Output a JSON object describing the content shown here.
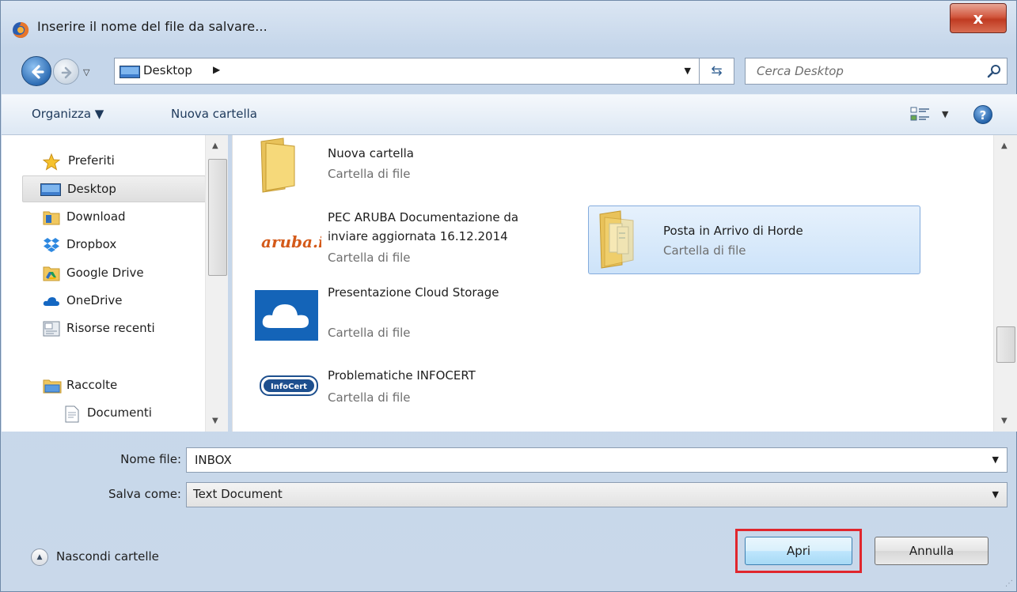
{
  "window": {
    "title": "Inserire il nome del file da salvare...",
    "close_glyph": "x"
  },
  "address": {
    "location": "Desktop",
    "separator_glyph": "▶",
    "search_placeholder": "Cerca Desktop"
  },
  "toolbar": {
    "organize_label": "Organizza ▼",
    "new_folder_label": "Nuova cartella",
    "help_glyph": "?"
  },
  "navigation": {
    "items": [
      {
        "label": "Preferiti",
        "icon": "star-icon"
      },
      {
        "label": "Desktop",
        "icon": "desktop-icon",
        "selected": true
      },
      {
        "label": "Download",
        "icon": "download-folder-icon"
      },
      {
        "label": "Dropbox",
        "icon": "dropbox-icon"
      },
      {
        "label": "Google Drive",
        "icon": "google-drive-icon"
      },
      {
        "label": "OneDrive",
        "icon": "onedrive-icon"
      },
      {
        "label": "Risorse recenti",
        "icon": "recent-places-icon"
      },
      {
        "label": "Raccolte",
        "icon": "libraries-icon"
      },
      {
        "label": "Documenti",
        "icon": "documents-icon"
      }
    ]
  },
  "files": [
    {
      "name": "Nuova cartella",
      "type": "Cartella di file",
      "icon": "folder-icon"
    },
    {
      "name": "PEC ARUBA Documentazione da inviare aggiornata 16.12.2014",
      "name_line1": "PEC ARUBA Documentazione da",
      "name_line2": "inviare aggiornata 16.12.2014",
      "type": "Cartella di file",
      "icon": "aruba-logo-icon",
      "logo_text": "aruba.it"
    },
    {
      "name": "Posta in Arrivo di Horde",
      "type": "Cartella di file",
      "icon": "folder-documents-icon",
      "selected": true
    },
    {
      "name": "Presentazione Cloud Storage",
      "type": "Cartella di file",
      "icon": "onedrive-cloud-icon"
    },
    {
      "name": "Problematiche INFOCERT",
      "type": "Cartella di file",
      "icon": "infocert-logo-icon",
      "logo_text": "InfoCert"
    }
  ],
  "form": {
    "filename_label": "Nome file:",
    "filename_value": "INBOX",
    "savetype_label": "Salva come:",
    "savetype_value": "Text Document"
  },
  "footer": {
    "hide_folders_label": "Nascondi cartelle",
    "open_label": "Apri",
    "cancel_label": "Annulla"
  },
  "colors": {
    "highlight": "#e0262d",
    "selection": "#cde3f9"
  }
}
